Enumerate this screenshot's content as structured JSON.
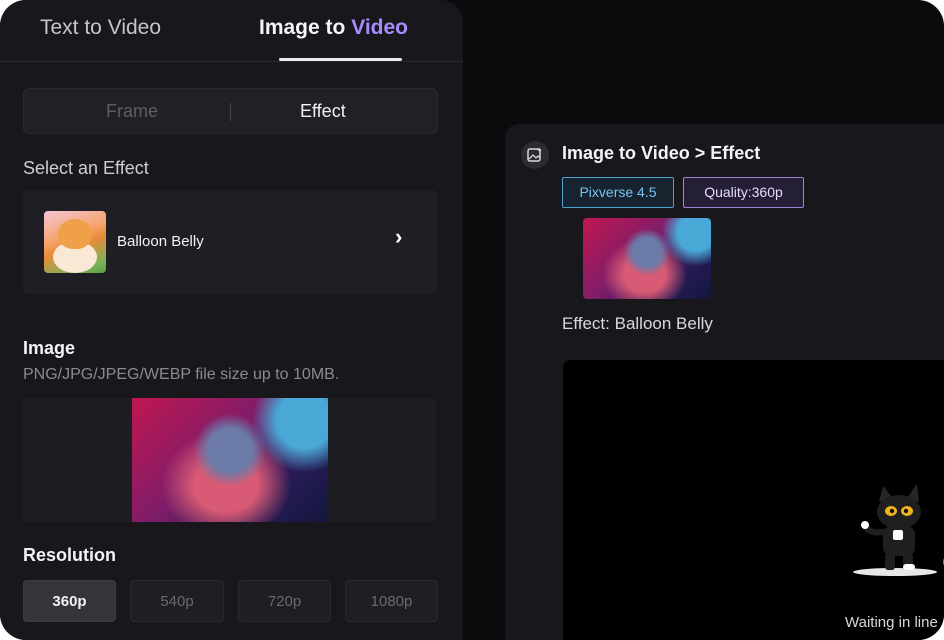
{
  "mode_tabs": {
    "text_to_video": "Text to Video",
    "image_to_video_prefix": "Image to ",
    "image_to_video_accent": "Video"
  },
  "sub_tabs": {
    "frame": "Frame",
    "effect": "Effect"
  },
  "effect_section": {
    "label": "Select an Effect",
    "selected_effect": "Balloon Belly"
  },
  "image_section": {
    "label": "Image",
    "hint": "PNG/JPG/JPEG/WEBP file size up to 10MB."
  },
  "resolution_section": {
    "label": "Resolution",
    "options": [
      "360p",
      "540p",
      "720p",
      "1080p"
    ],
    "selected": "360p"
  },
  "task": {
    "title": "Image to Video > Effect",
    "model_badge": "Pixverse 4.5",
    "quality_badge": "Quality:360p",
    "effect_caption": "Effect: Balloon Belly",
    "status": "Waiting in line"
  },
  "colors": {
    "accent": "#a88bff",
    "model_badge": "#4f9fd0",
    "quality_badge": "#9c84d8",
    "background": "#0b0b0d",
    "panel": "#18171c"
  }
}
